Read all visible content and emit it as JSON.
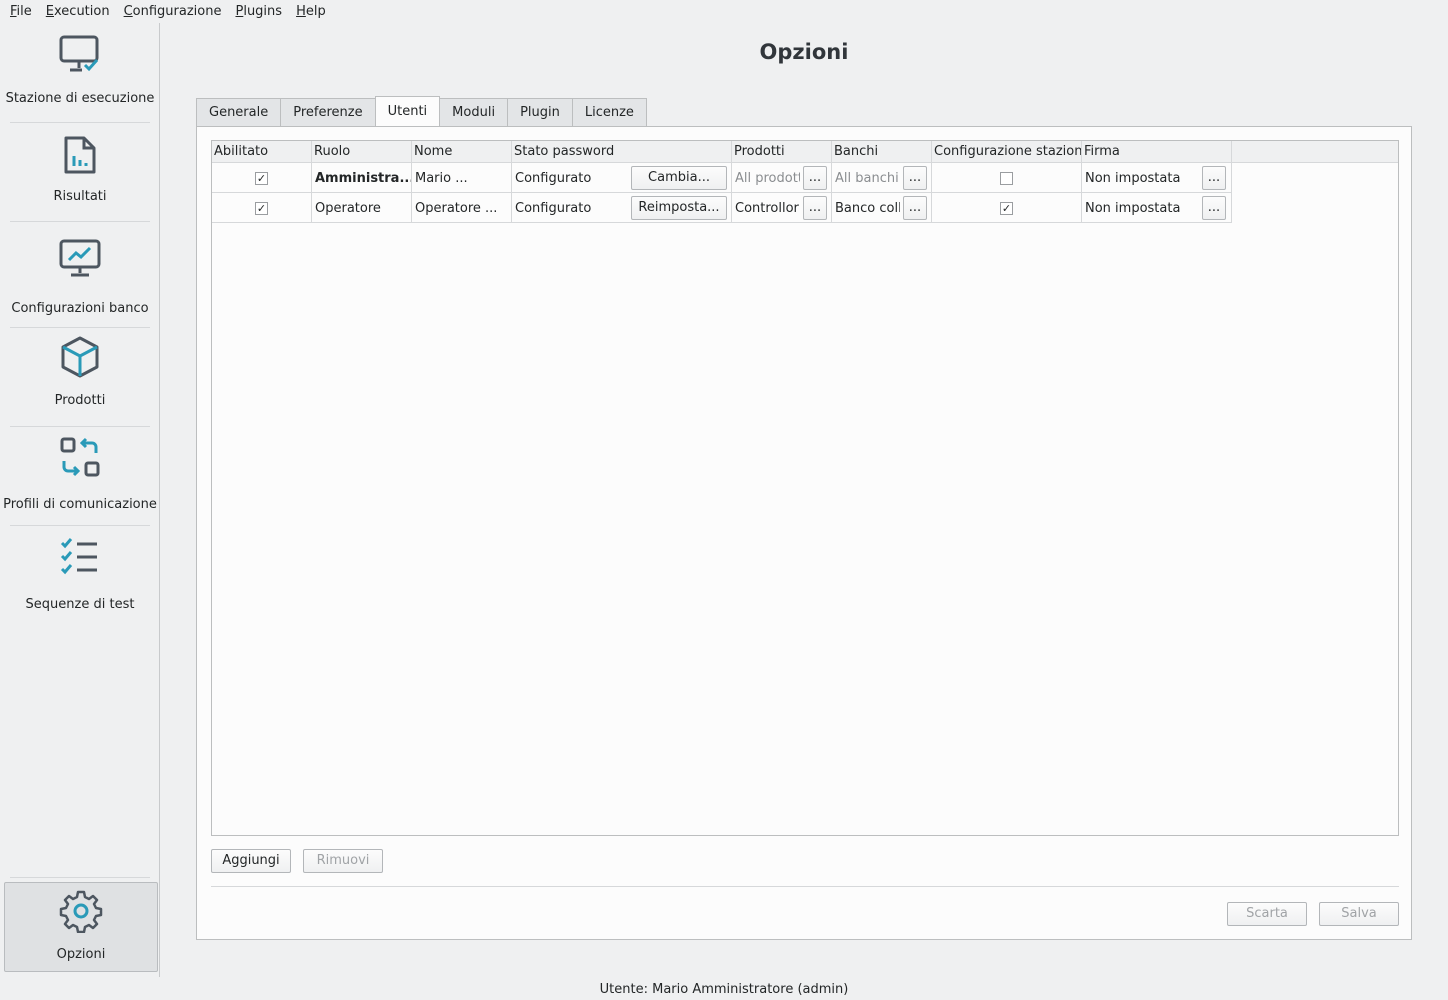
{
  "menu": [
    "File",
    "Execution",
    "Configurazione",
    "Plugins",
    "Help"
  ],
  "sidebar": {
    "items": [
      {
        "label": "Stazione di esecuzione",
        "icon": "monitor-check-icon"
      },
      {
        "label": "Risultati",
        "icon": "report-chart-icon"
      },
      {
        "label": "Configurazioni banco",
        "icon": "monitor-chart-icon"
      },
      {
        "label": "Prodotti",
        "icon": "cube-icon"
      },
      {
        "label": "Profili di comunicazione",
        "icon": "exchange-icon"
      },
      {
        "label": "Sequenze di test",
        "icon": "checklist-icon"
      }
    ],
    "active": {
      "label": "Opzioni",
      "icon": "gear-icon"
    }
  },
  "page": {
    "title": "Opzioni"
  },
  "tabs": [
    {
      "label": "Generale",
      "active": false
    },
    {
      "label": "Preferenze",
      "active": false
    },
    {
      "label": "Utenti",
      "active": true
    },
    {
      "label": "Moduli",
      "active": false
    },
    {
      "label": "Plugin",
      "active": false
    },
    {
      "label": "Licenze",
      "active": false
    }
  ],
  "table": {
    "columns": [
      "Abilitato",
      "Ruolo",
      "Nome",
      "Stato password",
      "Prodotti",
      "Banchi",
      "Configurazione stazione",
      "Firma"
    ],
    "rows": [
      {
        "enabled": true,
        "enabled_mark": "✓",
        "role": "Amministra...",
        "name": "Mario ...",
        "password_status": "Configurato",
        "password_button": "Cambia...",
        "products": "All prodotti",
        "products_button": "...",
        "benches": "All banchi",
        "benches_button": "...",
        "station_config": false,
        "station_config_mark": "",
        "signature": "Non impostata",
        "signature_button": "..."
      },
      {
        "enabled": true,
        "enabled_mark": "✓",
        "role": "Operatore",
        "name": "Operatore ...",
        "password_status": "Configurato",
        "password_button": "Reimposta...",
        "products": "Controllori",
        "products_button": "...",
        "benches": "Banco collaudo",
        "benches_button": "...",
        "station_config": true,
        "station_config_mark": "✓",
        "signature": "Non impostata",
        "signature_button": "..."
      }
    ]
  },
  "actions": {
    "add": "Aggiungi",
    "remove": "Rimuovi",
    "discard": "Scarta",
    "save": "Salva"
  },
  "status": {
    "user": "Utente: Mario Amministratore (admin)"
  },
  "colors": {
    "icon_gray": "#4d5660",
    "icon_accent": "#2a9ab8"
  }
}
